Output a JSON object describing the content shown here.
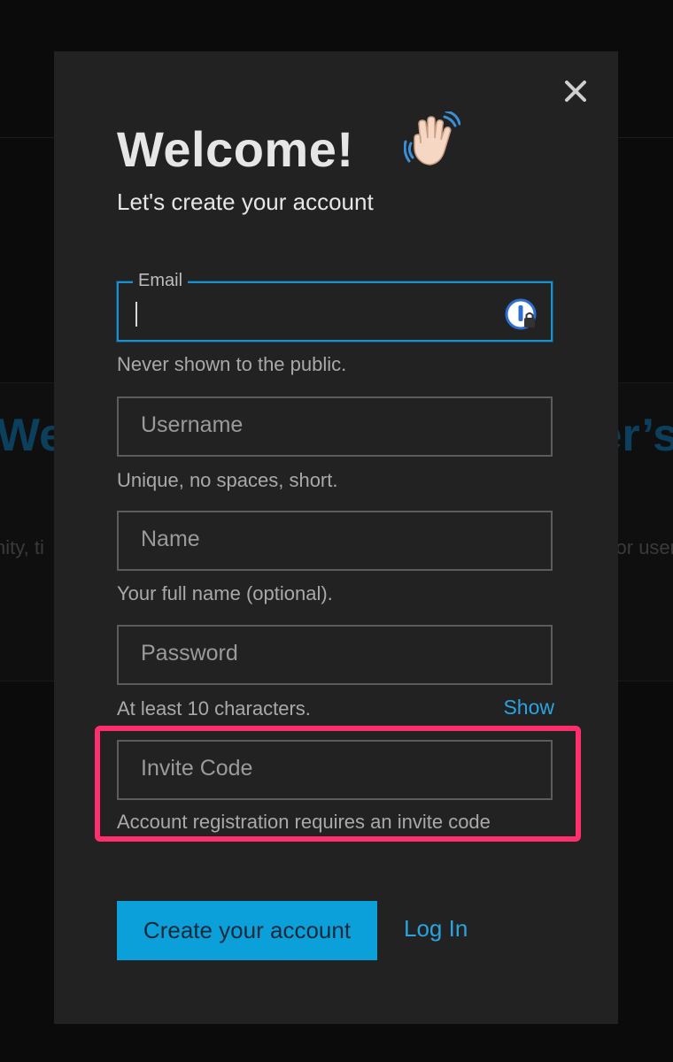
{
  "background": {
    "heading_left": "We",
    "heading_right": "er’s",
    "text_left": "nity, ti",
    "text_right": "or user"
  },
  "modal": {
    "title": "Welcome!",
    "subtitle": "Let's create your account",
    "close_icon": "close-icon",
    "wave_icon": "waving-hand-icon"
  },
  "form": {
    "email": {
      "label": "Email",
      "value": "",
      "help": "Never shown to the public.",
      "icon": "password-manager-icon"
    },
    "username": {
      "placeholder": "Username",
      "help": "Unique, no spaces, short."
    },
    "name": {
      "placeholder": "Name",
      "help": "Your full name (optional)."
    },
    "password": {
      "placeholder": "Password",
      "help": "At least 10 characters.",
      "show_label": "Show"
    },
    "invite_code": {
      "placeholder": "Invite Code",
      "help": "Account registration requires an invite code"
    }
  },
  "actions": {
    "create_label": "Create your account",
    "login_label": "Log In"
  },
  "colors": {
    "accent": "#0ba0da",
    "link": "#2aa4e0",
    "highlight": "#ff2f6d",
    "modal_bg": "#222222",
    "focus_border": "#1f8fc8"
  }
}
